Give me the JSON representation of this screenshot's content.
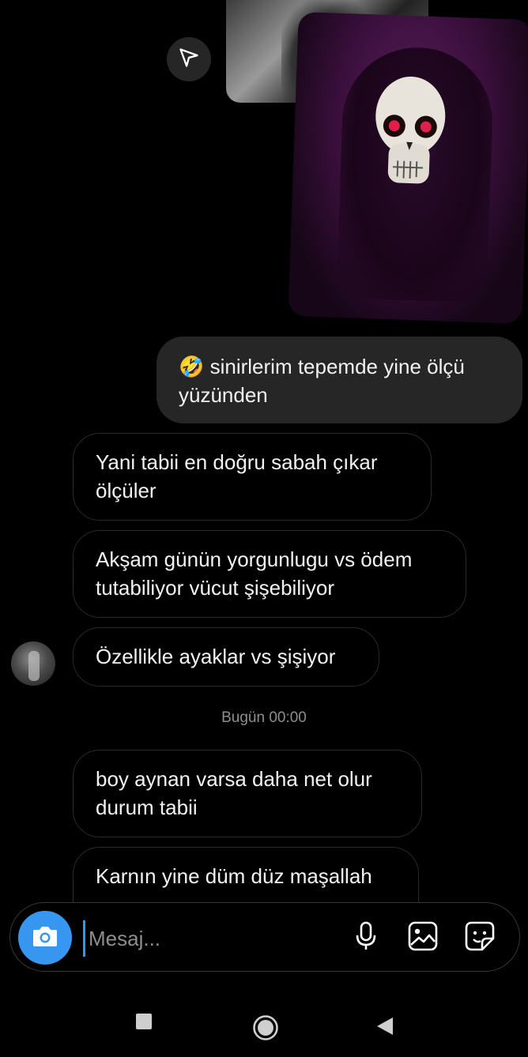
{
  "messages": {
    "sent": [
      {
        "emoji": "🤣",
        "text": "sinirlerim tepemde yine ölçü yüzünden"
      }
    ],
    "received": [
      {
        "text": "Yani tabii en doğru sabah çıkar ölçüler"
      },
      {
        "text": "Akşam günün yorgunlugu vs ödem tutabiliyor vücut şişebiliyor"
      },
      {
        "text": "Özellikle ayaklar vs şişiyor"
      },
      {
        "text": "boy aynan varsa daha net olur durum tabii"
      },
      {
        "text": "Karnın yine düm düz maşallah"
      }
    ]
  },
  "timestamp": "Bugün 00:00",
  "composer": {
    "placeholder": "Mesaj..."
  },
  "icons": {
    "share": "send-icon",
    "camera": "camera-icon",
    "mic": "microphone-icon",
    "gallery": "gallery-icon",
    "sticker": "sticker-icon",
    "nav": [
      "recents-icon",
      "home-icon",
      "back-icon"
    ]
  },
  "colors": {
    "accent": "#3797f0",
    "sent_bubble": "#262626",
    "background": "#000000"
  }
}
